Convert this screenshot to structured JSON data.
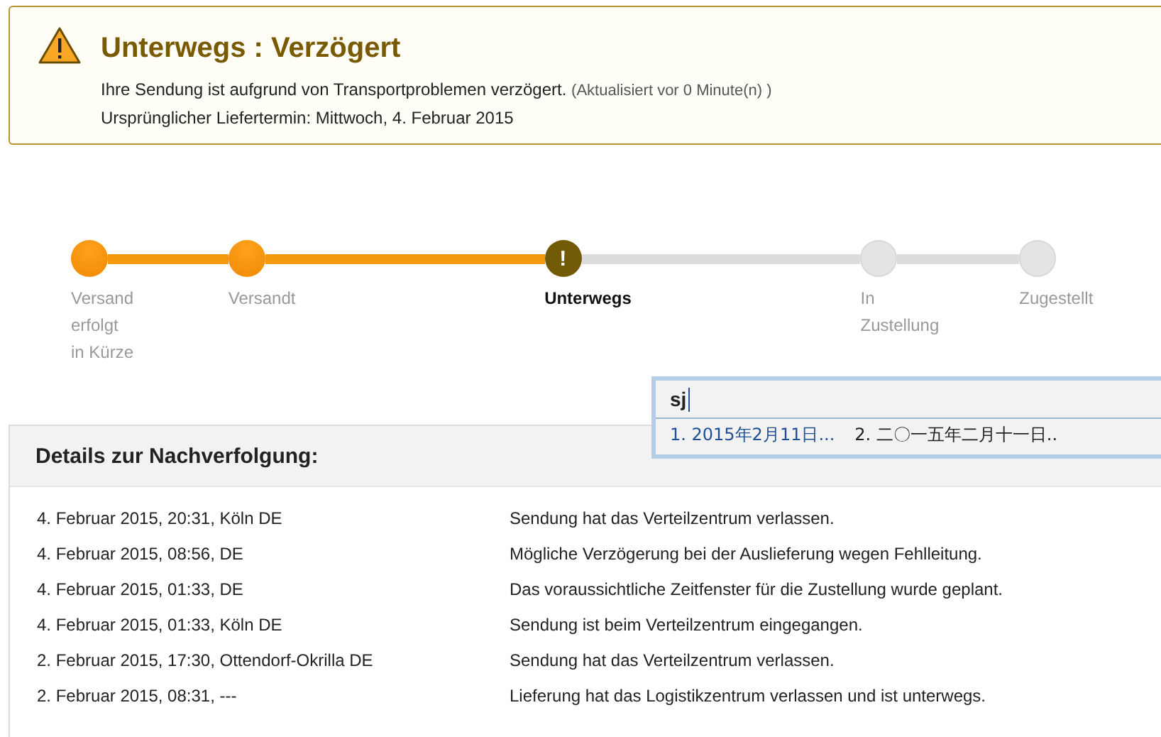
{
  "alert": {
    "title": "Unterwegs : Verzögert",
    "message": "Ihre Sendung ist aufgrund von Transportproblemen verzögert.",
    "updated": "(Aktualisiert vor 0 Minute(n) )",
    "original_date": "Ursprünglicher Liefertermin: Mittwoch, 4. Februar 2015"
  },
  "steps": [
    {
      "label": "Versand erfolgt in Kürze",
      "kind": "done"
    },
    {
      "label": "Versandt",
      "kind": "done"
    },
    {
      "label": "Unterwegs",
      "kind": "current",
      "icon_text": "!"
    },
    {
      "label": "In Zustellung",
      "kind": "pending"
    },
    {
      "label": "Zugestellt",
      "kind": "pending"
    }
  ],
  "ime": {
    "value": "sj",
    "candidates": [
      {
        "text": "1. 2015年2月11日...",
        "selected": true
      },
      {
        "text": "2. 二〇一五年二月十一日..",
        "selected": false
      }
    ]
  },
  "details": {
    "title": "Details zur Nachverfolgung:",
    "rows": [
      {
        "when": "4. Februar 2015, 20:31, Köln DE",
        "event": "Sendung hat das Verteilzentrum verlassen."
      },
      {
        "when": "4. Februar 2015, 08:56, DE",
        "event": "Mögliche Verzögerung bei der Auslieferung wegen Fehlleitung."
      },
      {
        "when": "4. Februar 2015, 01:33, DE",
        "event": "Das voraussichtliche Zeitfenster für die Zustellung wurde geplant."
      },
      {
        "when": "4. Februar 2015, 01:33, Köln DE",
        "event": "Sendung ist beim Verteilzentrum eingegangen."
      },
      {
        "when": "2. Februar 2015, 17:30, Ottendorf-Okrilla DE",
        "event": "Sendung hat das Verteilzentrum verlassen."
      },
      {
        "when": "2. Februar 2015, 08:31, ---",
        "event": "Lieferung hat das Logistikzentrum verlassen und ist unterwegs."
      }
    ]
  }
}
